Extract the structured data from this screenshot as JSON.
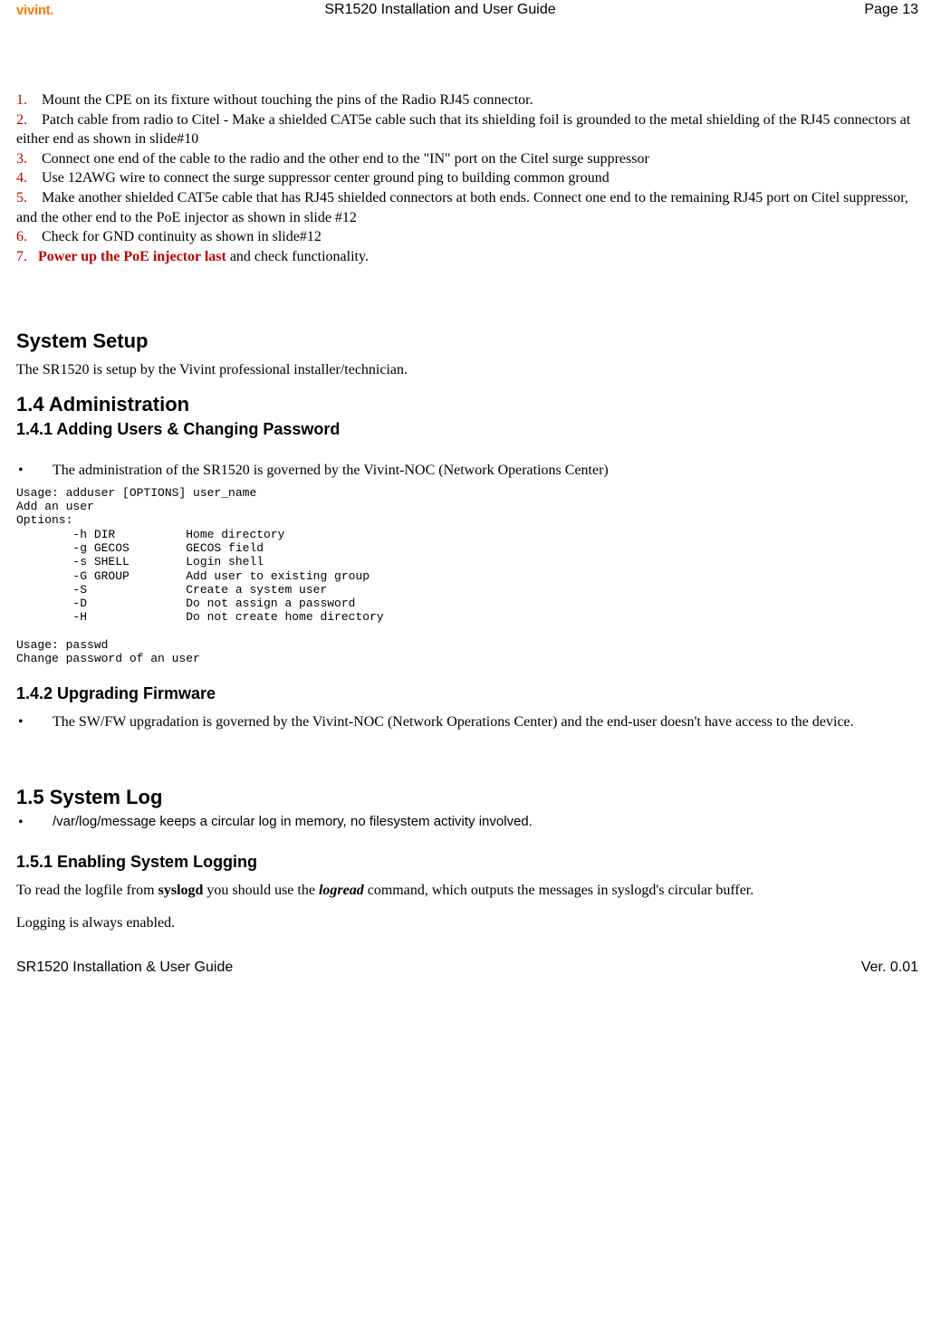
{
  "header": {
    "logo": "vivint.",
    "title": "SR1520 Installation and User Guide",
    "page": "Page 13"
  },
  "steps": [
    {
      "n": "1.",
      "t": " Mount the CPE on its fixture without touching the pins of the Radio RJ45 connector."
    },
    {
      "n": "2.",
      "t": " Patch cable from radio to Citel - Make a shielded CAT5e cable such that its shielding foil is grounded to the metal shielding of the RJ45 connectors at either end as shown in slide#10"
    },
    {
      "n": "3.",
      "t": " Connect one end of the cable to the radio and the other end to the \"IN\" port on the Citel surge suppressor"
    },
    {
      "n": "4.",
      "t": " Use 12AWG wire to connect the surge suppressor center ground ping to building common ground"
    },
    {
      "n": "5.",
      "t": " Make another shielded CAT5e cable that has RJ45 shielded connectors at both ends. Connect one end to the remaining RJ45 port on Citel suppressor, and the other end to the PoE injector as shown in slide #12"
    },
    {
      "n": "6.",
      "t": " Check for GND continuity as shown in slide#12"
    }
  ],
  "step7": {
    "n": "7.",
    "red": "Power up the PoE injector last",
    "rest": " and check functionality."
  },
  "system_setup": {
    "heading": "System Setup",
    "text": "The SR1520 is setup by the Vivint professional installer/technician."
  },
  "s14": {
    "heading": "1.4   Administration",
    "sub": "1.4.1 Adding Users & Changing Password",
    "bullet": "The administration of the SR1520 is governed by the Vivint-NOC (Network Operations Center)",
    "code": "Usage: adduser [OPTIONS] user_name\nAdd an user\nOptions:\n        -h DIR          Home directory\n        -g GECOS        GECOS field\n        -s SHELL        Login shell\n        -G GROUP        Add user to existing group\n        -S              Create a system user\n        -D              Do not assign a password\n        -H              Do not create home directory\n \nUsage: passwd\nChange password of an user"
  },
  "s142": {
    "heading": "1.4.2 Upgrading Firmware",
    "bullet": "The SW/FW upgradation is governed by the Vivint-NOC (Network Operations Center) and the end-user doesn't have access to the device."
  },
  "s15": {
    "heading": "1.5   System Log",
    "bullet": "/var/log/message keeps a circular log in memory, no filesystem activity involved."
  },
  "s151": {
    "heading": "1.5.1 Enabling System Logging",
    "p1a": "To read the logfile from ",
    "p1b": "syslogd",
    "p1c": " you should use the ",
    "p1d": "logread",
    "p1e": " command, which outputs the messages in syslogd's circular buffer.",
    "p2": "Logging is always enabled."
  },
  "footer": {
    "left": "SR1520 Installation & User Guide",
    "right": "Ver. 0.01"
  },
  "glyphs": {
    "bullet": "•"
  }
}
